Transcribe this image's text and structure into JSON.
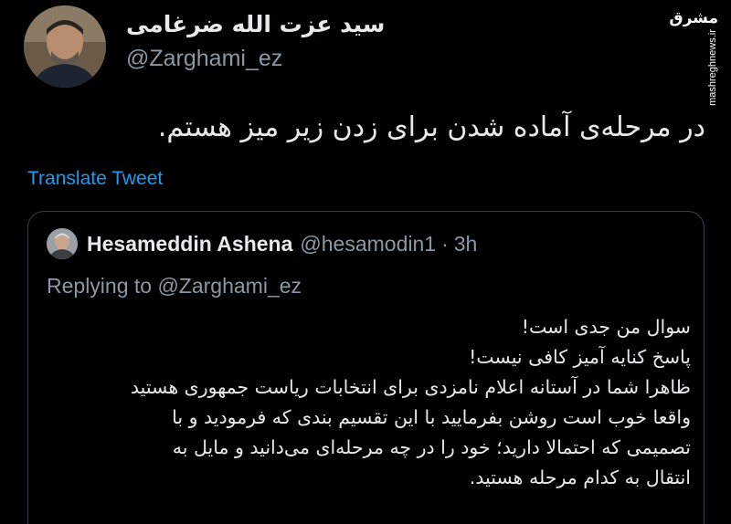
{
  "tweet": {
    "author": {
      "display_name": "سید عزت الله ضرغامی",
      "handle": "@Zarghami_ez"
    },
    "text": "در مرحله‌ی آماده شدن برای زدن زیر میز هستم.",
    "translate_label": "Translate Tweet"
  },
  "quoted_tweet": {
    "author": {
      "name": "Hesameddin Ashena",
      "handle": "@hesamodin1",
      "time": "3h"
    },
    "separator": "·",
    "replying_to": "Replying to @Zarghami_ez",
    "body_lines": [
      "سوال من جدی است!",
      "پاسخ کنایه آمیز کافی نیست!",
      "ظاهرا شما در آستانه اعلام نامزدی برای انتخابات ریاست جمهوری هستید",
      "واقعا خوب است روشن بفرمایید با این تقسیم بندی که فرمودید و با",
      "تصمیمی که احتمالا دارید؛ خود را در چه مرحله‌ای می‌دانید و مایل به",
      "انتقال به کدام مرحله هستید."
    ]
  },
  "watermark": {
    "logo_text": "مشرق",
    "url": "mashreghnews.ir"
  },
  "colors": {
    "background": "#000000",
    "text_primary": "#e7e9ea",
    "text_secondary": "#8b98a5",
    "link": "#1d9bf0",
    "border": "#3a3f44"
  }
}
